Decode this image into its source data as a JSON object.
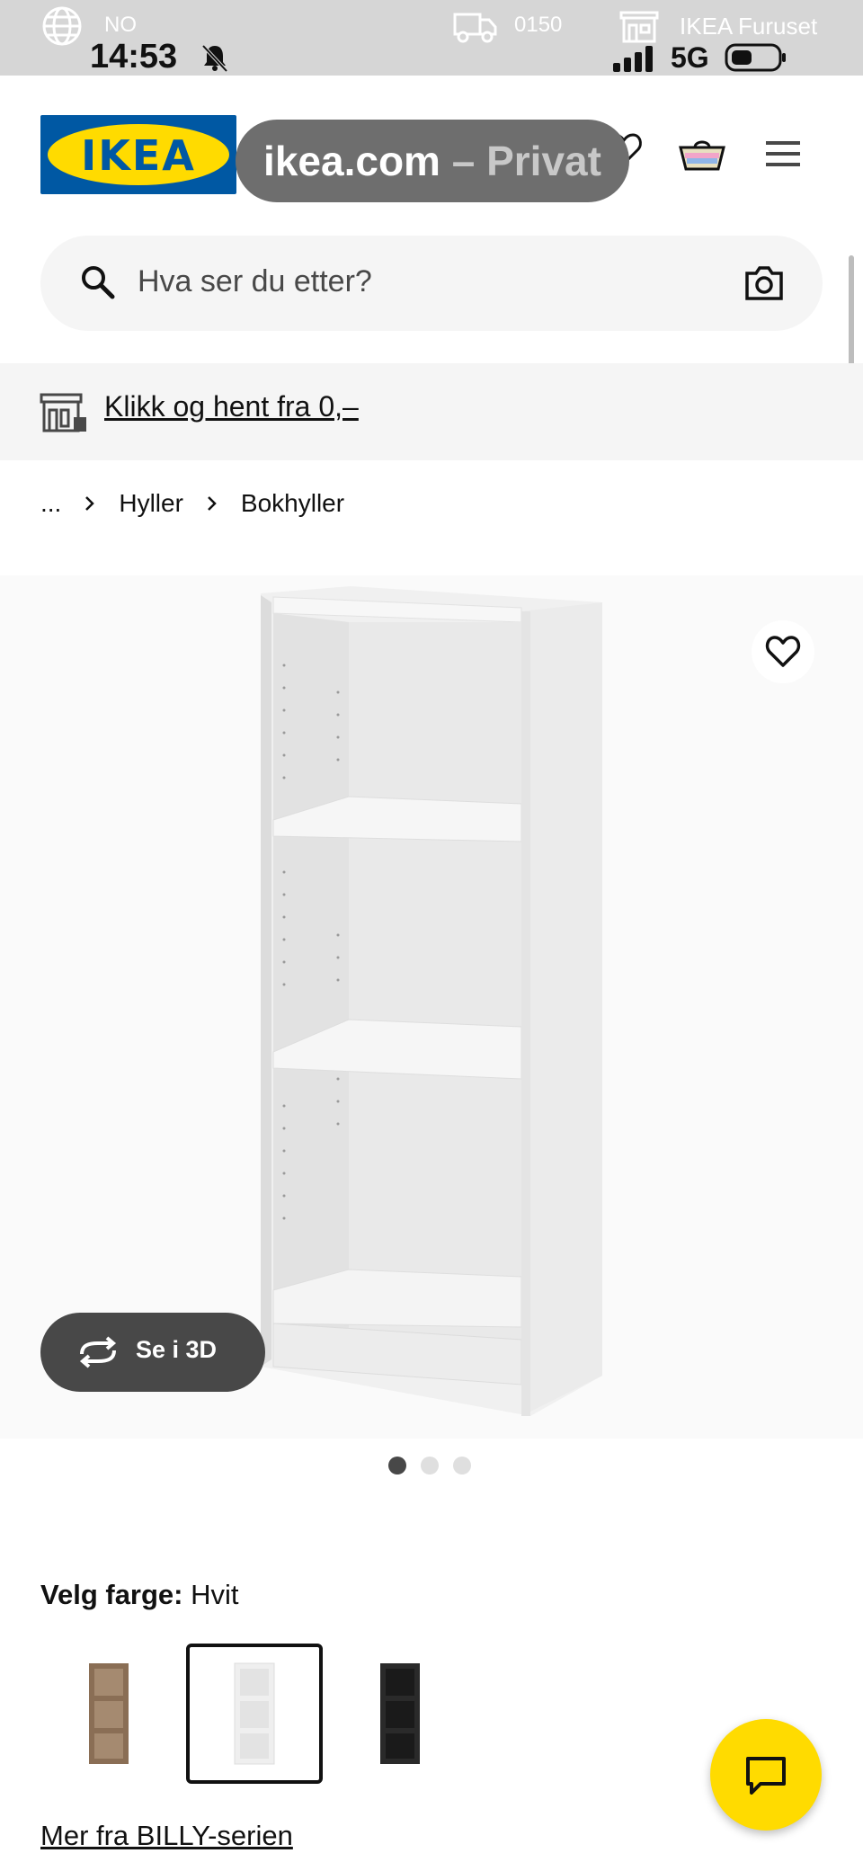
{
  "status_bar": {
    "carrier": "NO",
    "time": "14:53",
    "delivery_postcode": "0150",
    "store_name": "IKEA Furuset",
    "network": "5G"
  },
  "header": {
    "logo_text": "IKEA",
    "tab_title_main": "ikea.com",
    "tab_title_suffix": " – Privat"
  },
  "search": {
    "placeholder": "Hva ser du etter?"
  },
  "promo": {
    "text": "Klikk og hent fra 0,–"
  },
  "breadcrumb": {
    "items": [
      "...",
      "Hyller",
      "Bokhyller"
    ]
  },
  "product": {
    "view_3d_label": "Se i 3D",
    "image_count": 3,
    "active_image": 1
  },
  "color_selector": {
    "label": "Velg farge:",
    "selected_value": "Hvit",
    "swatches": [
      {
        "name": "walnut",
        "color": "#8a6e55"
      },
      {
        "name": "white",
        "color": "#f4f4f4"
      },
      {
        "name": "black",
        "color": "#2a2a2a"
      }
    ],
    "selected_index": 1
  },
  "series_link": "Mer fra BILLY-serien",
  "colors": {
    "brand_blue": "#0058a3",
    "brand_yellow": "#ffdb00",
    "dark_grey": "#484848"
  }
}
